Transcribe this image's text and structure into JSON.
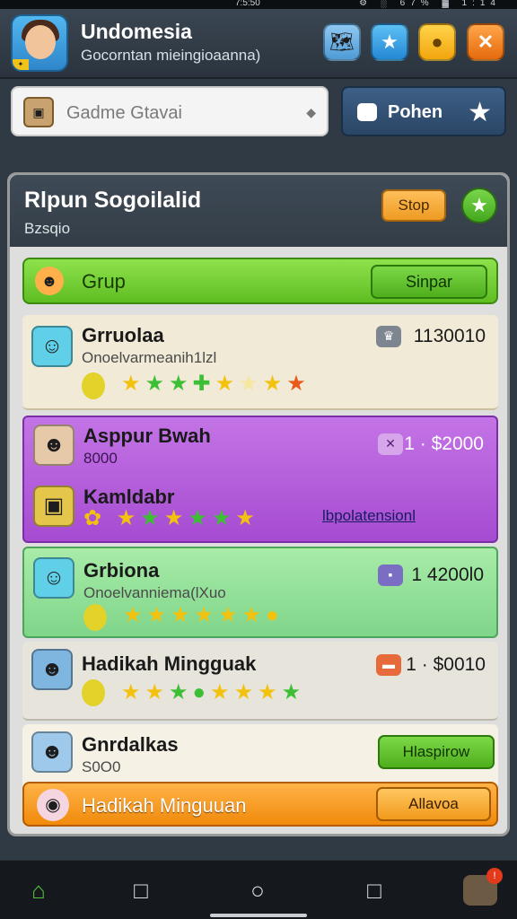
{
  "status_bar": {
    "time": "7:5:50",
    "icons": "⚙ ░ 67% ▓ 1:14"
  },
  "header": {
    "title": "Undomesia",
    "subtitle": "Gocorntan mieingioaanna)"
  },
  "search": {
    "placeholder": "Gadme Gtavai"
  },
  "phone_button": {
    "label": "Pohen"
  },
  "panel": {
    "title": "Rlpun Sogoilalid",
    "subtitle": "Bzsqio",
    "stop_label": "Stop"
  },
  "grup_bar": {
    "label": "Grup",
    "button_label": "Sinpar"
  },
  "rows": [
    {
      "name": "Grruolaa",
      "sub": "Onoelvarmeanih1lzl",
      "amount": "1130010"
    },
    {
      "name": "Asppur Bwah",
      "sub": "8000",
      "amount": "1 · $2000",
      "name2": "Kamldabr",
      "link": "lbpolatensionl"
    },
    {
      "name": "Grbiona",
      "sub": "Onoelvanniema(lXuo",
      "amount": "1 4200l0"
    },
    {
      "name": "Hadikah Mingguak",
      "amount": "1 · $0010"
    },
    {
      "name": "Gnrdalkas",
      "sub": "S0O0",
      "button_label": "Hlaspirow"
    }
  ],
  "orange_bar": {
    "label": "Hadikah Minguuan",
    "button_label": "Allavoa"
  },
  "colors": {
    "accent_green": "#5fbd22",
    "accent_orange": "#f08a0c",
    "accent_purple": "#a54bd1"
  }
}
